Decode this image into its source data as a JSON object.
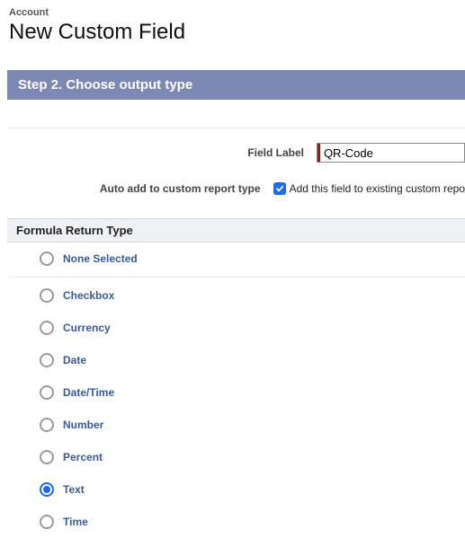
{
  "header": {
    "context": "Account",
    "title": "New Custom Field"
  },
  "step_bar": "Step 2. Choose output type",
  "form": {
    "field_label": {
      "label": "Field Label",
      "value": "QR-Code"
    },
    "auto_add": {
      "label": "Auto add to custom report type",
      "checkbox_label": "Add this field to existing custom repo",
      "checked": true
    }
  },
  "return_type_section": "Formula Return Type",
  "return_types": [
    {
      "label": "None Selected",
      "selected": false
    },
    {
      "label": "Checkbox",
      "selected": false
    },
    {
      "label": "Currency",
      "selected": false
    },
    {
      "label": "Date",
      "selected": false
    },
    {
      "label": "Date/Time",
      "selected": false
    },
    {
      "label": "Number",
      "selected": false
    },
    {
      "label": "Percent",
      "selected": false
    },
    {
      "label": "Text",
      "selected": true
    },
    {
      "label": "Time",
      "selected": false
    }
  ]
}
